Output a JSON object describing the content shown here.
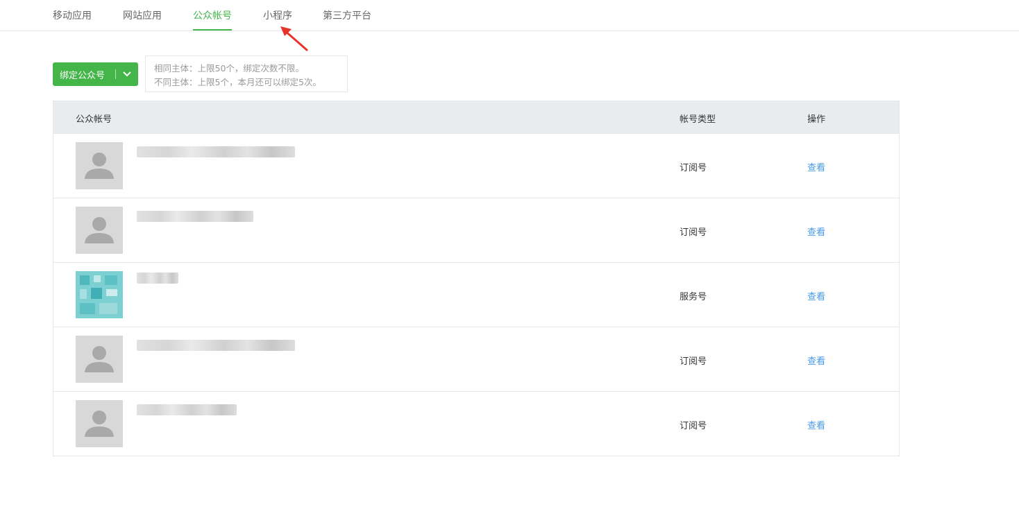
{
  "tabs": [
    {
      "label": "移动应用",
      "active": false
    },
    {
      "label": "网站应用",
      "active": false
    },
    {
      "label": "公众帐号",
      "active": true
    },
    {
      "label": "小程序",
      "active": false
    },
    {
      "label": "第三方平台",
      "active": false
    }
  ],
  "bind_button": {
    "label": "绑定公众号"
  },
  "tip": {
    "line1": "相同主体：上限50个，绑定次数不限。",
    "line2": "不同主体：上限5个，本月还可以绑定5次。"
  },
  "table": {
    "headers": {
      "account": "公众帐号",
      "type": "帐号类型",
      "action": "操作"
    },
    "rows": [
      {
        "type": "订阅号",
        "action": "查看",
        "avatar": "default-user-icon"
      },
      {
        "type": "订阅号",
        "action": "查看",
        "avatar": "default-user-icon"
      },
      {
        "type": "服务号",
        "action": "查看",
        "avatar": "qr-avatar"
      },
      {
        "type": "订阅号",
        "action": "查看",
        "avatar": "default-user-icon"
      },
      {
        "type": "订阅号",
        "action": "查看",
        "avatar": "default-user-icon"
      }
    ]
  },
  "colors": {
    "accent": "#44b549",
    "link": "#459ae9",
    "annotation_arrow": "#e8332a"
  }
}
